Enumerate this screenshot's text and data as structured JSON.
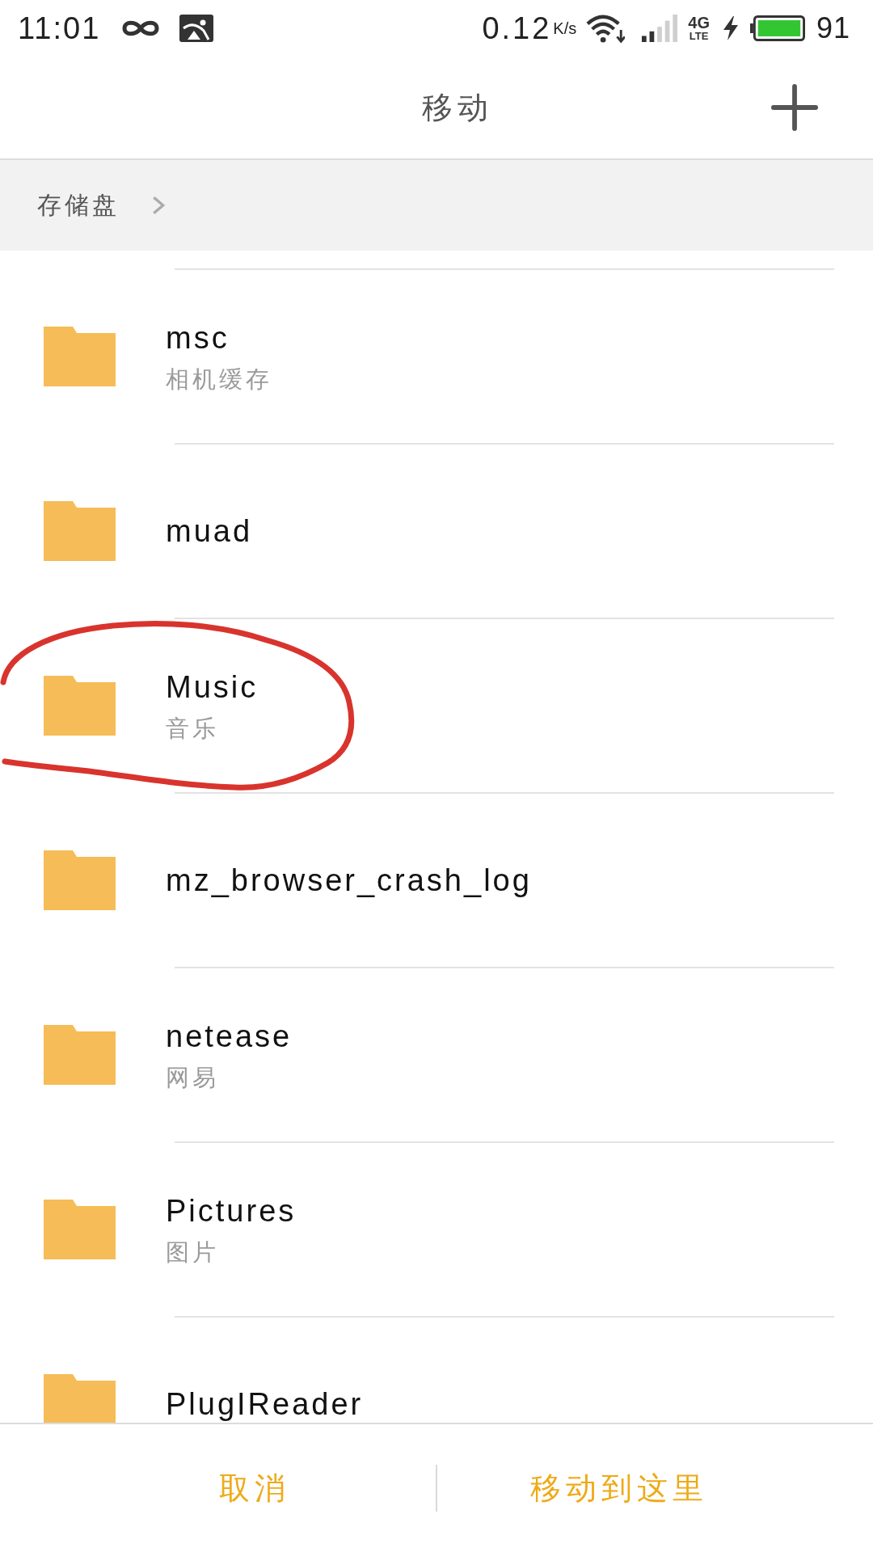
{
  "status_bar": {
    "time": "11:01",
    "speed": "0.12",
    "speed_unit": "K/s",
    "network": "4G",
    "network_sub": "LTE",
    "battery": "91"
  },
  "header": {
    "title": "移动"
  },
  "breadcrumb": [
    {
      "label": "存储盘"
    }
  ],
  "folders": [
    {
      "name": "msc",
      "subtitle": "相机缓存",
      "circled": false
    },
    {
      "name": "muad",
      "circled": false
    },
    {
      "name": "Music",
      "subtitle": "音乐",
      "circled": true
    },
    {
      "name": "mz_browser_crash_log",
      "circled": false
    },
    {
      "name": "netease",
      "subtitle": "网易",
      "circled": false
    },
    {
      "name": "Pictures",
      "subtitle": "图片",
      "circled": false
    },
    {
      "name": "PlugIReader",
      "circled": false
    }
  ],
  "buttons": [
    {
      "label": "取消"
    },
    {
      "label": "移动到这里"
    }
  ]
}
